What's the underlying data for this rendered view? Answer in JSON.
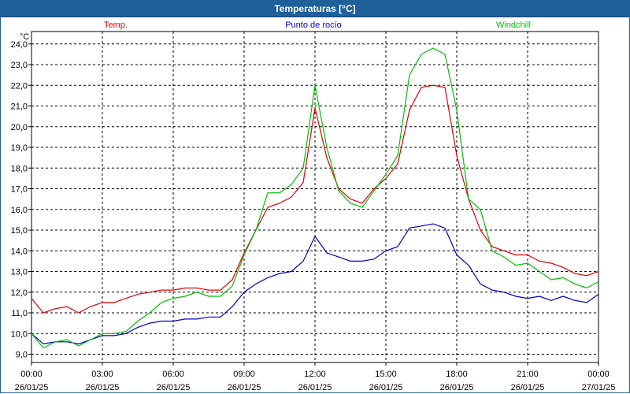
{
  "window": {
    "title": "Temperaturas [°C]"
  },
  "chart_data": {
    "type": "line",
    "title": "Temperaturas [°C]",
    "ylabel": "°C",
    "ylim": [
      8.6,
      24.6
    ],
    "yticks": [
      "9,0",
      "10,0",
      "11,0",
      "12,0",
      "13,0",
      "14,0",
      "15,0",
      "16,0",
      "17,0",
      "18,0",
      "19,0",
      "20,0",
      "21,0",
      "22,0",
      "23,0",
      "24,0"
    ],
    "xlim": [
      0,
      24
    ],
    "xticks": [
      {
        "t": "00:00",
        "d": "26/01/25"
      },
      {
        "t": "03:00",
        "d": "26/01/25"
      },
      {
        "t": "06:00",
        "d": "26/01/25"
      },
      {
        "t": "09:00",
        "d": "26/01/25"
      },
      {
        "t": "12:00",
        "d": "26/01/25"
      },
      {
        "t": "15:00",
        "d": "26/01/25"
      },
      {
        "t": "18:00",
        "d": "26/01/25"
      },
      {
        "t": "21:00",
        "d": "26/01/25"
      },
      {
        "t": "00:00",
        "d": "27/01/25"
      }
    ],
    "grid": true,
    "legend_position": "top",
    "series": [
      {
        "name": "Temp.",
        "color": "#e00000",
        "x": [
          0,
          0.5,
          1,
          1.5,
          2,
          2.5,
          3,
          3.5,
          4,
          4.5,
          5,
          5.5,
          6,
          6.5,
          7,
          7.5,
          8,
          8.5,
          9,
          9.5,
          10,
          10.5,
          11,
          11.5,
          12,
          12.5,
          13,
          13.5,
          14,
          14.5,
          15,
          15.5,
          16,
          16.5,
          17,
          17.5,
          18,
          18.5,
          19,
          19.5,
          20,
          20.5,
          21,
          21.5,
          22,
          22.5,
          23,
          23.5,
          24
        ],
        "y": [
          11.7,
          11.0,
          11.2,
          11.3,
          11.0,
          11.3,
          11.5,
          11.5,
          11.7,
          11.9,
          12.0,
          12.1,
          12.1,
          12.2,
          12.2,
          12.1,
          12.1,
          12.6,
          13.9,
          15.0,
          16.1,
          16.3,
          16.6,
          17.3,
          20.9,
          18.5,
          17.0,
          16.5,
          16.3,
          17.0,
          17.5,
          18.2,
          20.8,
          21.9,
          22.0,
          21.9,
          18.6,
          16.5,
          15.0,
          14.2,
          14.0,
          13.8,
          13.8,
          13.5,
          13.4,
          13.2,
          12.9,
          12.8,
          13.0
        ]
      },
      {
        "name": "Punto de rocío",
        "color": "#0000c8",
        "x": [
          0,
          0.5,
          1,
          1.5,
          2,
          2.5,
          3,
          3.5,
          4,
          4.5,
          5,
          5.5,
          6,
          6.5,
          7,
          7.5,
          8,
          8.5,
          9,
          9.5,
          10,
          10.5,
          11,
          11.5,
          12,
          12.5,
          13,
          13.5,
          14,
          14.5,
          15,
          15.5,
          16,
          16.5,
          17,
          17.5,
          18,
          18.5,
          19,
          19.5,
          20,
          20.5,
          21,
          21.5,
          22,
          22.5,
          23,
          23.5,
          24
        ],
        "y": [
          10.0,
          9.5,
          9.6,
          9.6,
          9.5,
          9.7,
          9.9,
          9.9,
          10.0,
          10.3,
          10.5,
          10.6,
          10.6,
          10.7,
          10.7,
          10.8,
          10.8,
          11.3,
          12.0,
          12.4,
          12.7,
          12.9,
          13.0,
          13.5,
          14.7,
          13.9,
          13.7,
          13.5,
          13.5,
          13.6,
          14.0,
          14.2,
          15.1,
          15.2,
          15.3,
          15.1,
          13.8,
          13.3,
          12.4,
          12.1,
          12.0,
          11.8,
          11.7,
          11.8,
          11.6,
          11.8,
          11.6,
          11.5,
          11.9
        ]
      },
      {
        "name": "Windchill",
        "color": "#00c000",
        "x": [
          0,
          0.5,
          1,
          1.5,
          2,
          2.5,
          3,
          3.5,
          4,
          4.5,
          5,
          5.5,
          6,
          6.5,
          7,
          7.5,
          8,
          8.5,
          9,
          9.5,
          10,
          10.5,
          11,
          11.5,
          12,
          12.5,
          13,
          13.5,
          14,
          14.5,
          15,
          15.5,
          16,
          16.5,
          17,
          17.5,
          18,
          18.5,
          19,
          19.5,
          20,
          20.5,
          21,
          21.5,
          22,
          22.5,
          23,
          23.5,
          24
        ],
        "y": [
          10.0,
          9.3,
          9.6,
          9.7,
          9.4,
          9.7,
          10.0,
          10.0,
          10.1,
          10.6,
          11.0,
          11.5,
          11.7,
          11.8,
          12.0,
          11.8,
          11.8,
          12.3,
          13.8,
          15.0,
          16.8,
          16.8,
          17.2,
          18.0,
          22.0,
          19.0,
          16.9,
          16.3,
          16.1,
          16.9,
          17.7,
          18.6,
          22.5,
          23.5,
          23.8,
          23.5,
          20.8,
          16.5,
          16.0,
          14.0,
          13.7,
          13.3,
          13.4,
          13.0,
          12.6,
          12.7,
          12.4,
          12.2,
          12.5
        ]
      }
    ]
  }
}
